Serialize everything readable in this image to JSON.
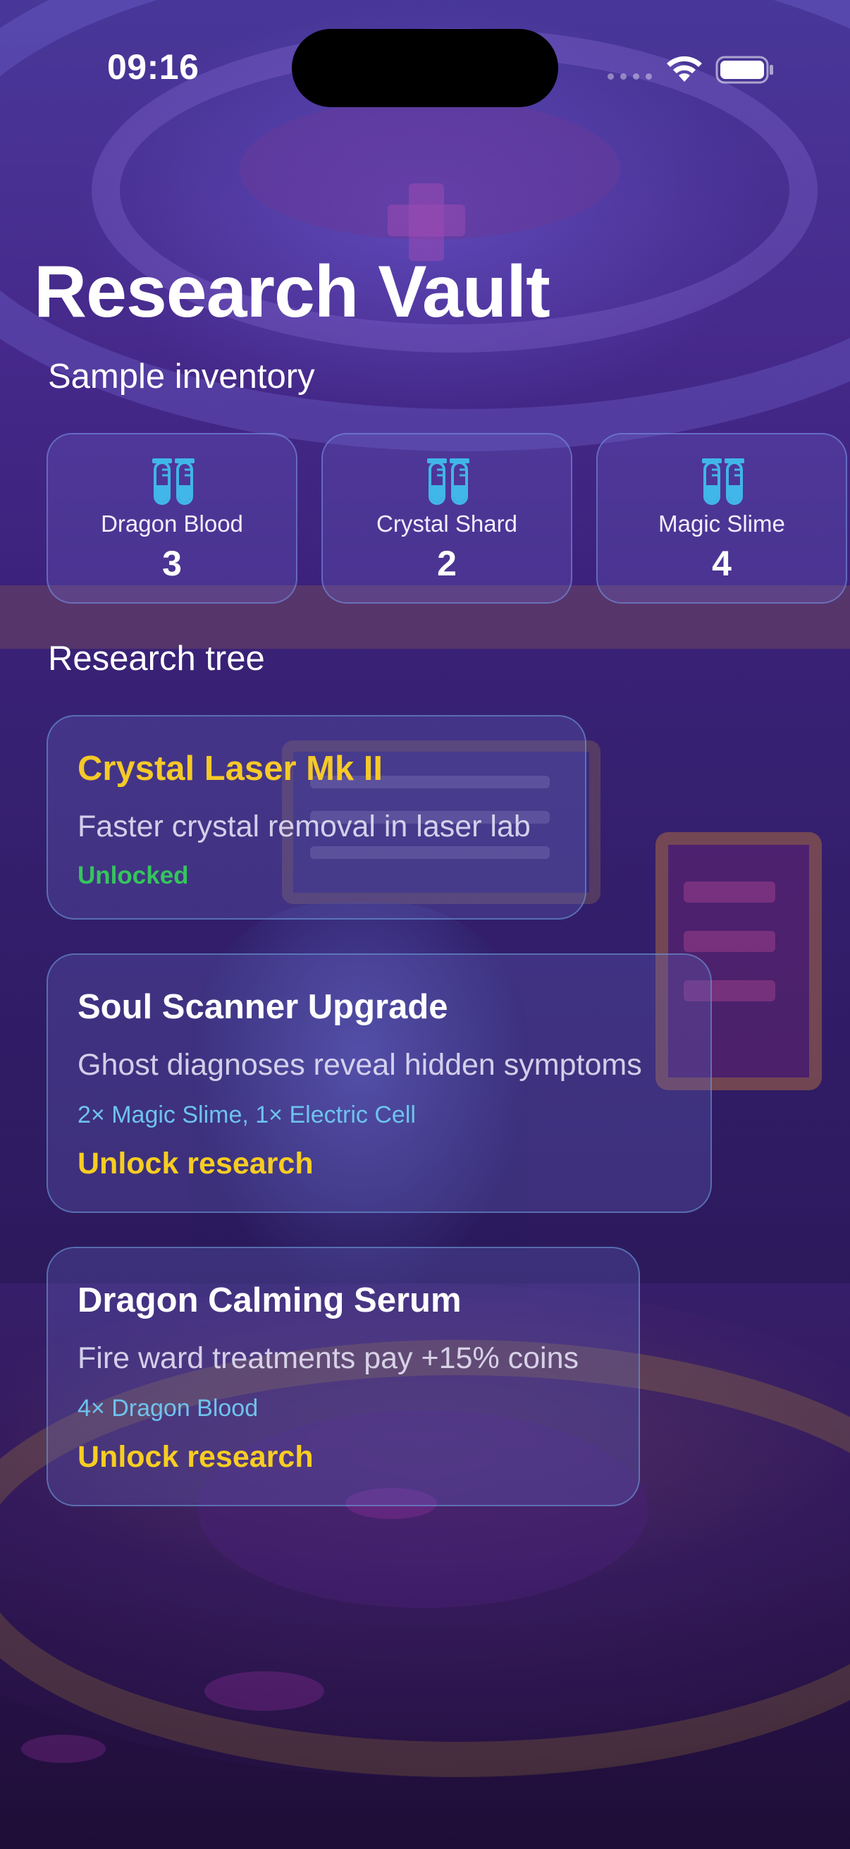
{
  "status_bar": {
    "time": "09:16"
  },
  "page": {
    "title": "Research Vault"
  },
  "sections": {
    "inventory": "Sample inventory",
    "tree": "Research tree"
  },
  "inventory": [
    {
      "name": "Dragon Blood",
      "count": "3",
      "icon": "test-tubes-icon"
    },
    {
      "name": "Crystal Shard",
      "count": "2",
      "icon": "test-tubes-icon"
    },
    {
      "name": "Magic Slime",
      "count": "4",
      "icon": "test-tubes-icon"
    }
  ],
  "research": [
    {
      "title": "Crystal Laser Mk II",
      "description": "Faster crystal removal in laser lab",
      "status": "Unlocked",
      "cost": null,
      "action": null
    },
    {
      "title": "Soul Scanner Upgrade",
      "description": "Ghost diagnoses reveal hidden symptoms",
      "cost": "2× Magic Slime, 1× Electric Cell",
      "action": "Unlock research"
    },
    {
      "title": "Dragon Calming Serum",
      "description": "Fire ward treatments pay +15% coins",
      "cost": "4× Dragon Blood",
      "action": "Unlock research"
    }
  ],
  "colors": {
    "unlocked_title": "#f5c928",
    "unlocked_status": "#34c65c",
    "action": "#f7cd22",
    "cost": "#6ec3ee",
    "tube_icon": "#41b6e8"
  }
}
